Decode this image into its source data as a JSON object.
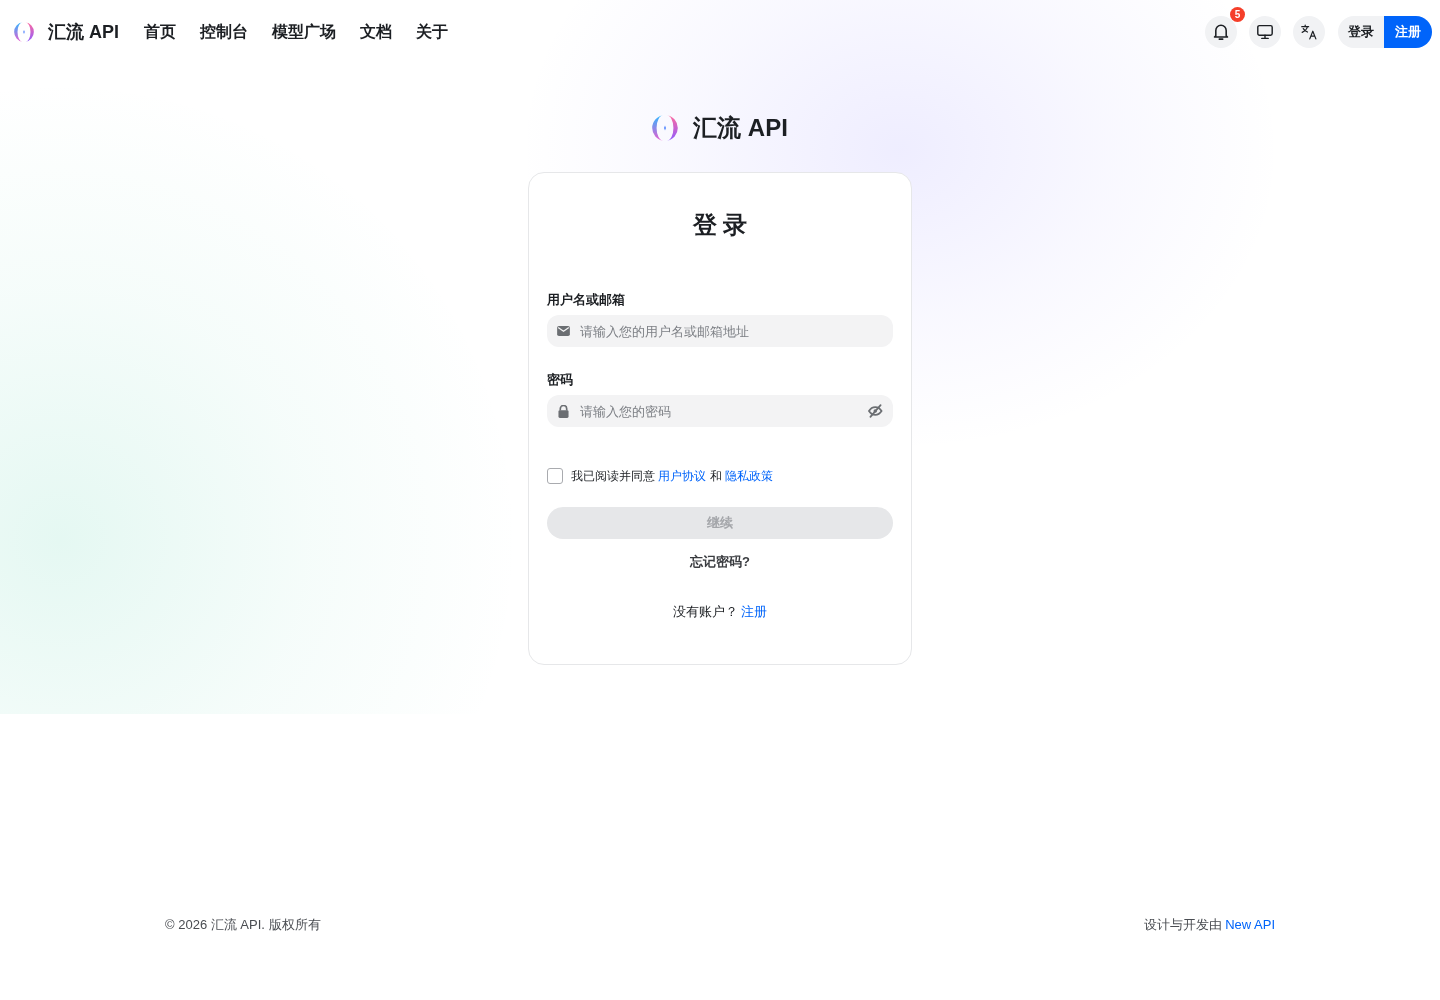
{
  "header": {
    "brand": "汇流 API",
    "nav": [
      {
        "label": "首页"
      },
      {
        "label": "控制台"
      },
      {
        "label": "模型广场"
      },
      {
        "label": "文档"
      },
      {
        "label": "关于"
      }
    ],
    "notification_count": "5",
    "login_button": "登录",
    "register_button": "注册"
  },
  "hero": {
    "brand": "汇流 API"
  },
  "login_card": {
    "title": "登 录",
    "fields": [
      {
        "kind": "text",
        "label": "用户名或邮箱",
        "placeholder": "请输入您的用户名或邮箱地址"
      },
      {
        "kind": "password",
        "label": "密码",
        "placeholder": "请输入您的密码"
      }
    ],
    "agreement": {
      "checked": false,
      "text": "我已阅读并同意",
      "terms_link": "用户协议",
      "joiner": "和",
      "privacy_link": "隐私政策"
    },
    "continue_button": {
      "label": "继续",
      "disabled": true
    },
    "forgot_password": "忘记密码?",
    "signup_prompt": "没有账户？",
    "signup_link": "注册"
  },
  "footer": {
    "copyright": "© 2026 汇流 API. 版权所有",
    "credit": "设计与开发由",
    "credit_link": "New API"
  }
}
